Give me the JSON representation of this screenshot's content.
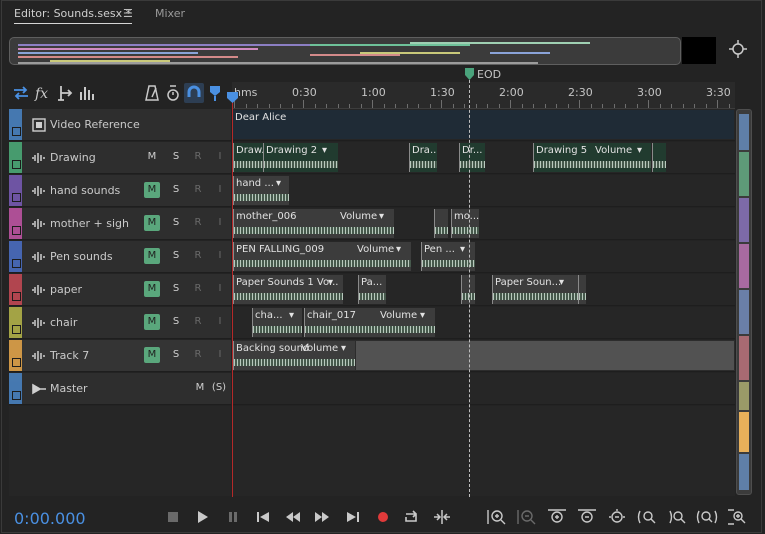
{
  "tabs": {
    "editor": "Editor: Sounds.sesx *",
    "menu_glyph": "☰",
    "mixer": "Mixer"
  },
  "ruler": {
    "labels": [
      "hms",
      "0:30",
      "1:00",
      "1:30",
      "2:00",
      "2:30",
      "3:00",
      "3:30"
    ],
    "eod_label": "EOD"
  },
  "tracks": [
    {
      "name": "Video Reference",
      "color": "#4a86c7",
      "m": "",
      "s": "",
      "r": "",
      "i": ""
    },
    {
      "name": "Drawing",
      "color": "#4caf7a",
      "m": "M",
      "m_on": false,
      "s": "S",
      "r": "R",
      "i": "I"
    },
    {
      "name": "hand sounds",
      "color": "#7a5bb8",
      "m": "M",
      "m_on": true,
      "s": "S",
      "r": "R",
      "i": "I"
    },
    {
      "name": "mother + sigh",
      "color": "#c455a8",
      "m": "M",
      "m_on": true,
      "s": "S",
      "r": "R",
      "i": "I"
    },
    {
      "name": "Pen sounds",
      "color": "#4a6fc7",
      "m": "M",
      "m_on": true,
      "s": "S",
      "r": "R",
      "i": "I"
    },
    {
      "name": "paper",
      "color": "#c94a55",
      "m": "M",
      "m_on": true,
      "s": "S",
      "r": "R",
      "i": "I"
    },
    {
      "name": "chair",
      "color": "#b8b84a",
      "m": "M",
      "m_on": true,
      "s": "S",
      "r": "R",
      "i": "I"
    },
    {
      "name": "Track 7",
      "color": "#e8a84a",
      "m": "M",
      "m_on": true,
      "s": "S",
      "r": "R",
      "i": "I"
    },
    {
      "name": "Master",
      "color": "#4a86c7",
      "m": "M",
      "m_on": false,
      "s": "(S)",
      "r": "",
      "i": ""
    }
  ],
  "clips": {
    "video": {
      "name": "Dear Alice"
    },
    "drawing": [
      {
        "name": "Draw..."
      },
      {
        "name": "Drawing 2"
      },
      {
        "name": "Dra..."
      },
      {
        "name": "Dr..."
      },
      {
        "name": "Drawing 5",
        "vol": "Volume"
      }
    ],
    "hand": [
      {
        "name": "hand ..."
      }
    ],
    "mother": [
      {
        "name": "mother_006",
        "vol": "Volume"
      },
      {
        "name": "mo..."
      }
    ],
    "pen": [
      {
        "name": "PEN FALLING_009",
        "vol": "Volume"
      },
      {
        "name": "Pen ..."
      }
    ],
    "paper": [
      {
        "name": "Paper Sounds 1 Vo..."
      },
      {
        "name": "Pa..."
      },
      {
        "name": "Paper Soun..."
      }
    ],
    "chair": [
      {
        "name": "cha..."
      },
      {
        "name": "chair_017",
        "vol": "Volume"
      }
    ],
    "track7": [
      {
        "name": "Backing sound",
        "vol": "Volume"
      }
    ]
  },
  "transport": {
    "timecode": "0:00.000",
    "buttons": [
      "stop",
      "play",
      "pause",
      "go-to-start",
      "rewind",
      "fast-forward",
      "go-to-end",
      "record",
      "loop",
      "skip-selection"
    ],
    "record_color": "#e03a3a"
  },
  "zoom_buttons": [
    "zoom-in-amplitude",
    "zoom-out-amplitude",
    "zoom-in-time",
    "zoom-out-time",
    "zoom-out-full",
    "zoom-in-in-point",
    "zoom-in-out-point",
    "zoom-to-selection",
    "zoom-selected-tracks"
  ],
  "colors": {
    "accent": "#4a90e2",
    "playhead": "#b42929",
    "mute_on": "#5aa77c"
  }
}
